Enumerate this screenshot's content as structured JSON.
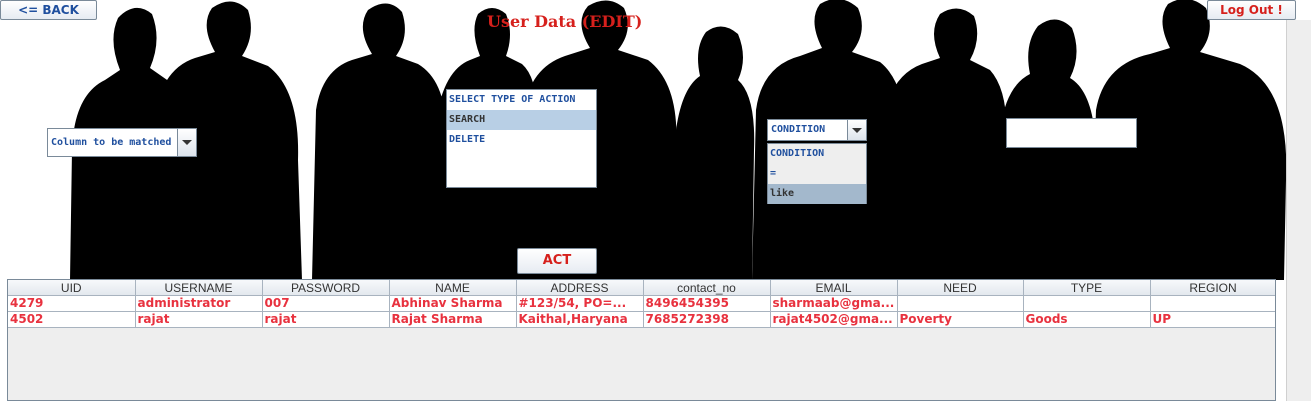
{
  "header": {
    "back_label": "<= BACK",
    "title": "User Data (EDIT)",
    "logout_label": "Log Out !"
  },
  "filters": {
    "column_combo_value": "Column to be matched",
    "action_list": {
      "options": [
        "SELECT TYPE OF ACTION",
        "SEARCH",
        "DELETE"
      ],
      "selected": "SEARCH"
    },
    "condition_combo_value": "CONDITION",
    "condition_options": [
      "CONDITION",
      "=",
      "like"
    ],
    "condition_selected": "like",
    "value_input": ""
  },
  "act_label": "ACT",
  "table": {
    "columns": [
      "UID",
      "USERNAME",
      "PASSWORD",
      "NAME",
      "ADDRESS",
      "contact_no",
      "EMAIL",
      "NEED",
      "TYPE",
      "REGION"
    ],
    "rows": [
      [
        "4279",
        "administrator",
        "007",
        "Abhinav Sharma",
        "#123/54, PO=...",
        "8496454395",
        "sharmaab@gma...",
        "",
        "",
        ""
      ],
      [
        "4502",
        "rajat",
        "rajat",
        "Rajat Sharma",
        "Kaithal,Haryana",
        "7685272398",
        "rajat4502@gma...",
        "Poverty",
        "Goods",
        "UP"
      ]
    ]
  },
  "colors": {
    "title": "#d6201c",
    "cell_text": "#e8323f",
    "label_blue": "#1f4f9e",
    "silhouette": "#000000"
  }
}
